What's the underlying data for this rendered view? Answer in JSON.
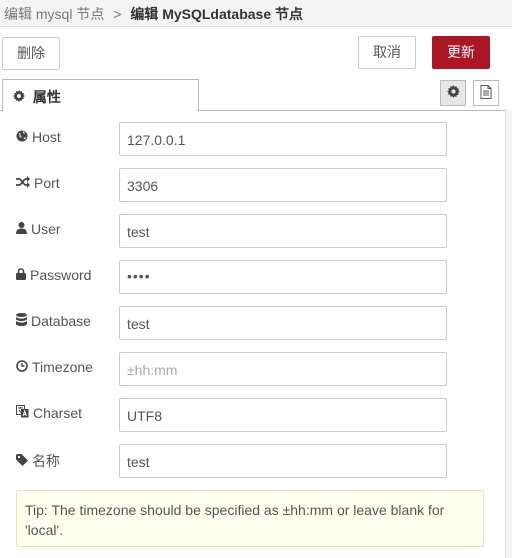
{
  "breadcrumb": {
    "parent": "编辑 mysql 节点",
    "separator": ">",
    "current": "编辑 MySQLdatabase 节点"
  },
  "toolbar": {
    "delete_label": "删除",
    "cancel_label": "取消",
    "update_label": "更新",
    "update_color": "#ad1625"
  },
  "tabs": {
    "properties_label": "属性"
  },
  "fields": {
    "host": {
      "label": "Host",
      "value": "127.0.0.1",
      "icon": "globe-icon"
    },
    "port": {
      "label": "Port",
      "value": "3306",
      "icon": "random-icon"
    },
    "user": {
      "label": "User",
      "value": "test",
      "icon": "user-icon"
    },
    "password": {
      "label": "Password",
      "value": "••••",
      "icon": "lock-icon"
    },
    "database": {
      "label": "Database",
      "value": "test",
      "icon": "database-icon"
    },
    "timezone": {
      "label": "Timezone",
      "placeholder": "±hh:mm",
      "icon": "clock-icon"
    },
    "charset": {
      "label": "Charset",
      "value": "UTF8",
      "icon": "language-icon"
    },
    "name": {
      "label": "名称",
      "value": "test",
      "icon": "tag-icon"
    }
  },
  "tip": {
    "text": "Tip: The timezone should be specified as ±hh:mm or leave blank for 'local'."
  }
}
